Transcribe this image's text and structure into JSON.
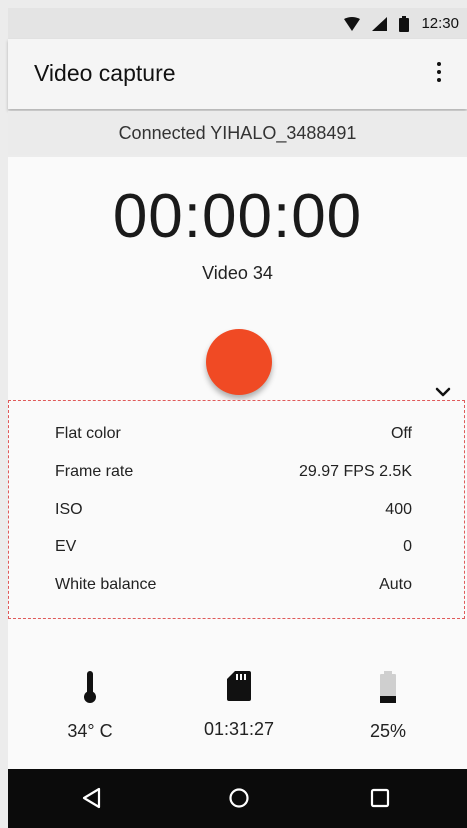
{
  "status_bar": {
    "time": "12:30",
    "icons": [
      "wifi-icon",
      "signal-icon",
      "battery-icon"
    ]
  },
  "app_bar": {
    "title": "Video capture",
    "menu_icon": "more-vert-icon"
  },
  "connection": {
    "text": "Connected YIHALO_3488491"
  },
  "recording": {
    "timer": "00:00:00",
    "video_name": "Video 34",
    "record_color": "#f04a24",
    "expand_icon": "chevron-down-icon"
  },
  "settings": [
    {
      "label": "Flat color",
      "value": "Off"
    },
    {
      "label": "Frame rate",
      "value": "29.97 FPS 2.5K"
    },
    {
      "label": "ISO",
      "value": "400"
    },
    {
      "label": "EV",
      "value": "0"
    },
    {
      "label": "White balance",
      "value": "Auto"
    }
  ],
  "stats": {
    "temperature": {
      "icon": "thermometer-icon",
      "value": "34° C"
    },
    "storage": {
      "icon": "sd-card-icon",
      "value": "01:31:27"
    },
    "battery": {
      "icon": "battery-level-icon",
      "value": "25%",
      "level": 0.25
    }
  },
  "nav_bar": {
    "icons": [
      "back-icon",
      "home-icon",
      "recents-icon"
    ]
  }
}
